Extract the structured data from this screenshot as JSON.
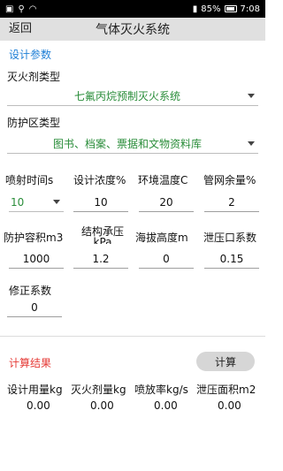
{
  "status": {
    "battery": "85%",
    "time": "7:08"
  },
  "toolbar": {
    "back_label": "返回",
    "title": "气体灭火系统"
  },
  "design": {
    "section_title": "设计参数",
    "agent_type_label": "灭火剂类型",
    "agent_type_value": "七氟丙烷预制灭火系统",
    "zone_type_label": "防护区类型",
    "zone_type_value": "图书、档案、票据和文物资料库",
    "params_row1": [
      {
        "label": "喷射时间s",
        "value": "10"
      },
      {
        "label": "设计浓度%",
        "value": "10"
      },
      {
        "label": "环境温度C",
        "value": "20"
      },
      {
        "label": "管网余量%",
        "value": "2"
      }
    ],
    "params_row2": [
      {
        "label": "防护容积m3",
        "value": "1000"
      },
      {
        "label": "结构承压kPa",
        "value": "1.2"
      },
      {
        "label": "海拔高度m",
        "value": "0"
      },
      {
        "label": "泄压口系数",
        "value": "0.15"
      }
    ],
    "correction_label": "修正系数",
    "correction_value": "0"
  },
  "result": {
    "section_title": "计算结果",
    "calc_button": "计算",
    "items": [
      {
        "label": "设计用量kg",
        "value": "0.00"
      },
      {
        "label": "灭火剂量kg",
        "value": "0.00"
      },
      {
        "label": "喷放率kg/s",
        "value": "0.00"
      },
      {
        "label": "泄压面积m2",
        "value": "0.00"
      }
    ]
  },
  "colors": {
    "accent_blue": "#1e7fd6",
    "value_green": "#2a8d3a",
    "result_red": "#e53935"
  }
}
